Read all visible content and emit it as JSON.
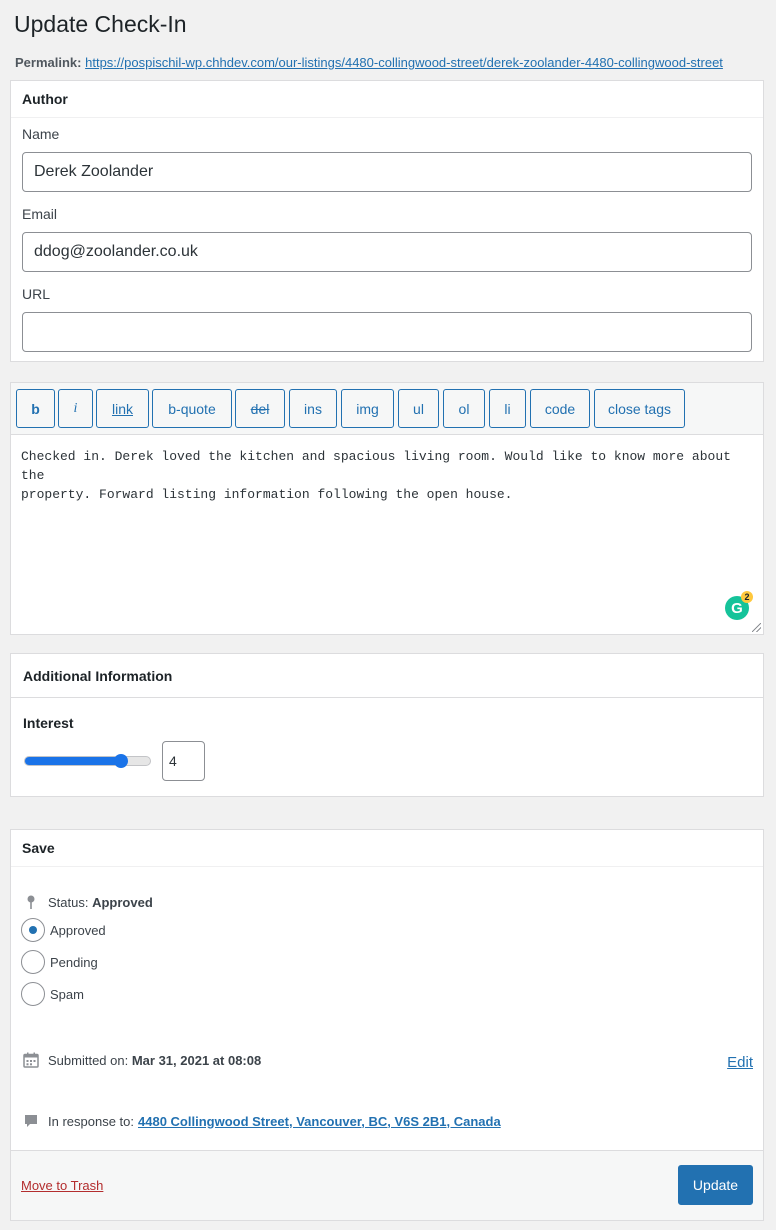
{
  "page": {
    "title": "Update Check-In",
    "permalink_label": "Permalink:",
    "permalink_url": "https://pospischil-wp.chhdev.com/our-listings/4480-collingwood-street/derek-zoolander-4480-collingwood-street"
  },
  "author": {
    "header": "Author",
    "name_label": "Name",
    "name_value": "Derek Zoolander",
    "email_label": "Email",
    "email_value": "ddog@zoolander.co.uk",
    "url_label": "URL",
    "url_value": ""
  },
  "editor": {
    "quicktags": [
      "b",
      "i",
      "link",
      "b-quote",
      "del",
      "ins",
      "img",
      "ul",
      "ol",
      "li",
      "code",
      "close tags"
    ],
    "content": "Checked in. Derek loved the kitchen and spacious living room. Would like to know more about the\nproperty. Forward listing information following the open house.",
    "grammarly_count": "2",
    "grammarly_letter": "G"
  },
  "additional_info": {
    "header": "Additional Information",
    "interest_label": "Interest",
    "interest_value": "4",
    "interest_max": 5
  },
  "save": {
    "header": "Save",
    "status_label": "Status:",
    "status_value": "Approved",
    "options": [
      "Approved",
      "Pending",
      "Spam"
    ],
    "selected": "Approved",
    "submitted_label": "Submitted on:",
    "submitted_value": "Mar 31, 2021 at 08:08",
    "edit_label": "Edit",
    "response_label": "In response to:",
    "response_link": "4480 Collingwood Street, Vancouver, BC, V6S 2B1, Canada",
    "trash_label": "Move to Trash",
    "update_label": "Update"
  },
  "colors": {
    "accent": "#2271b1",
    "slider": "#1a73e8",
    "danger": "#b32d2e",
    "grammarly": "#15c39a"
  },
  "icons": {
    "status": "pin-icon",
    "submitted": "calendar-icon",
    "response": "comment-icon"
  }
}
